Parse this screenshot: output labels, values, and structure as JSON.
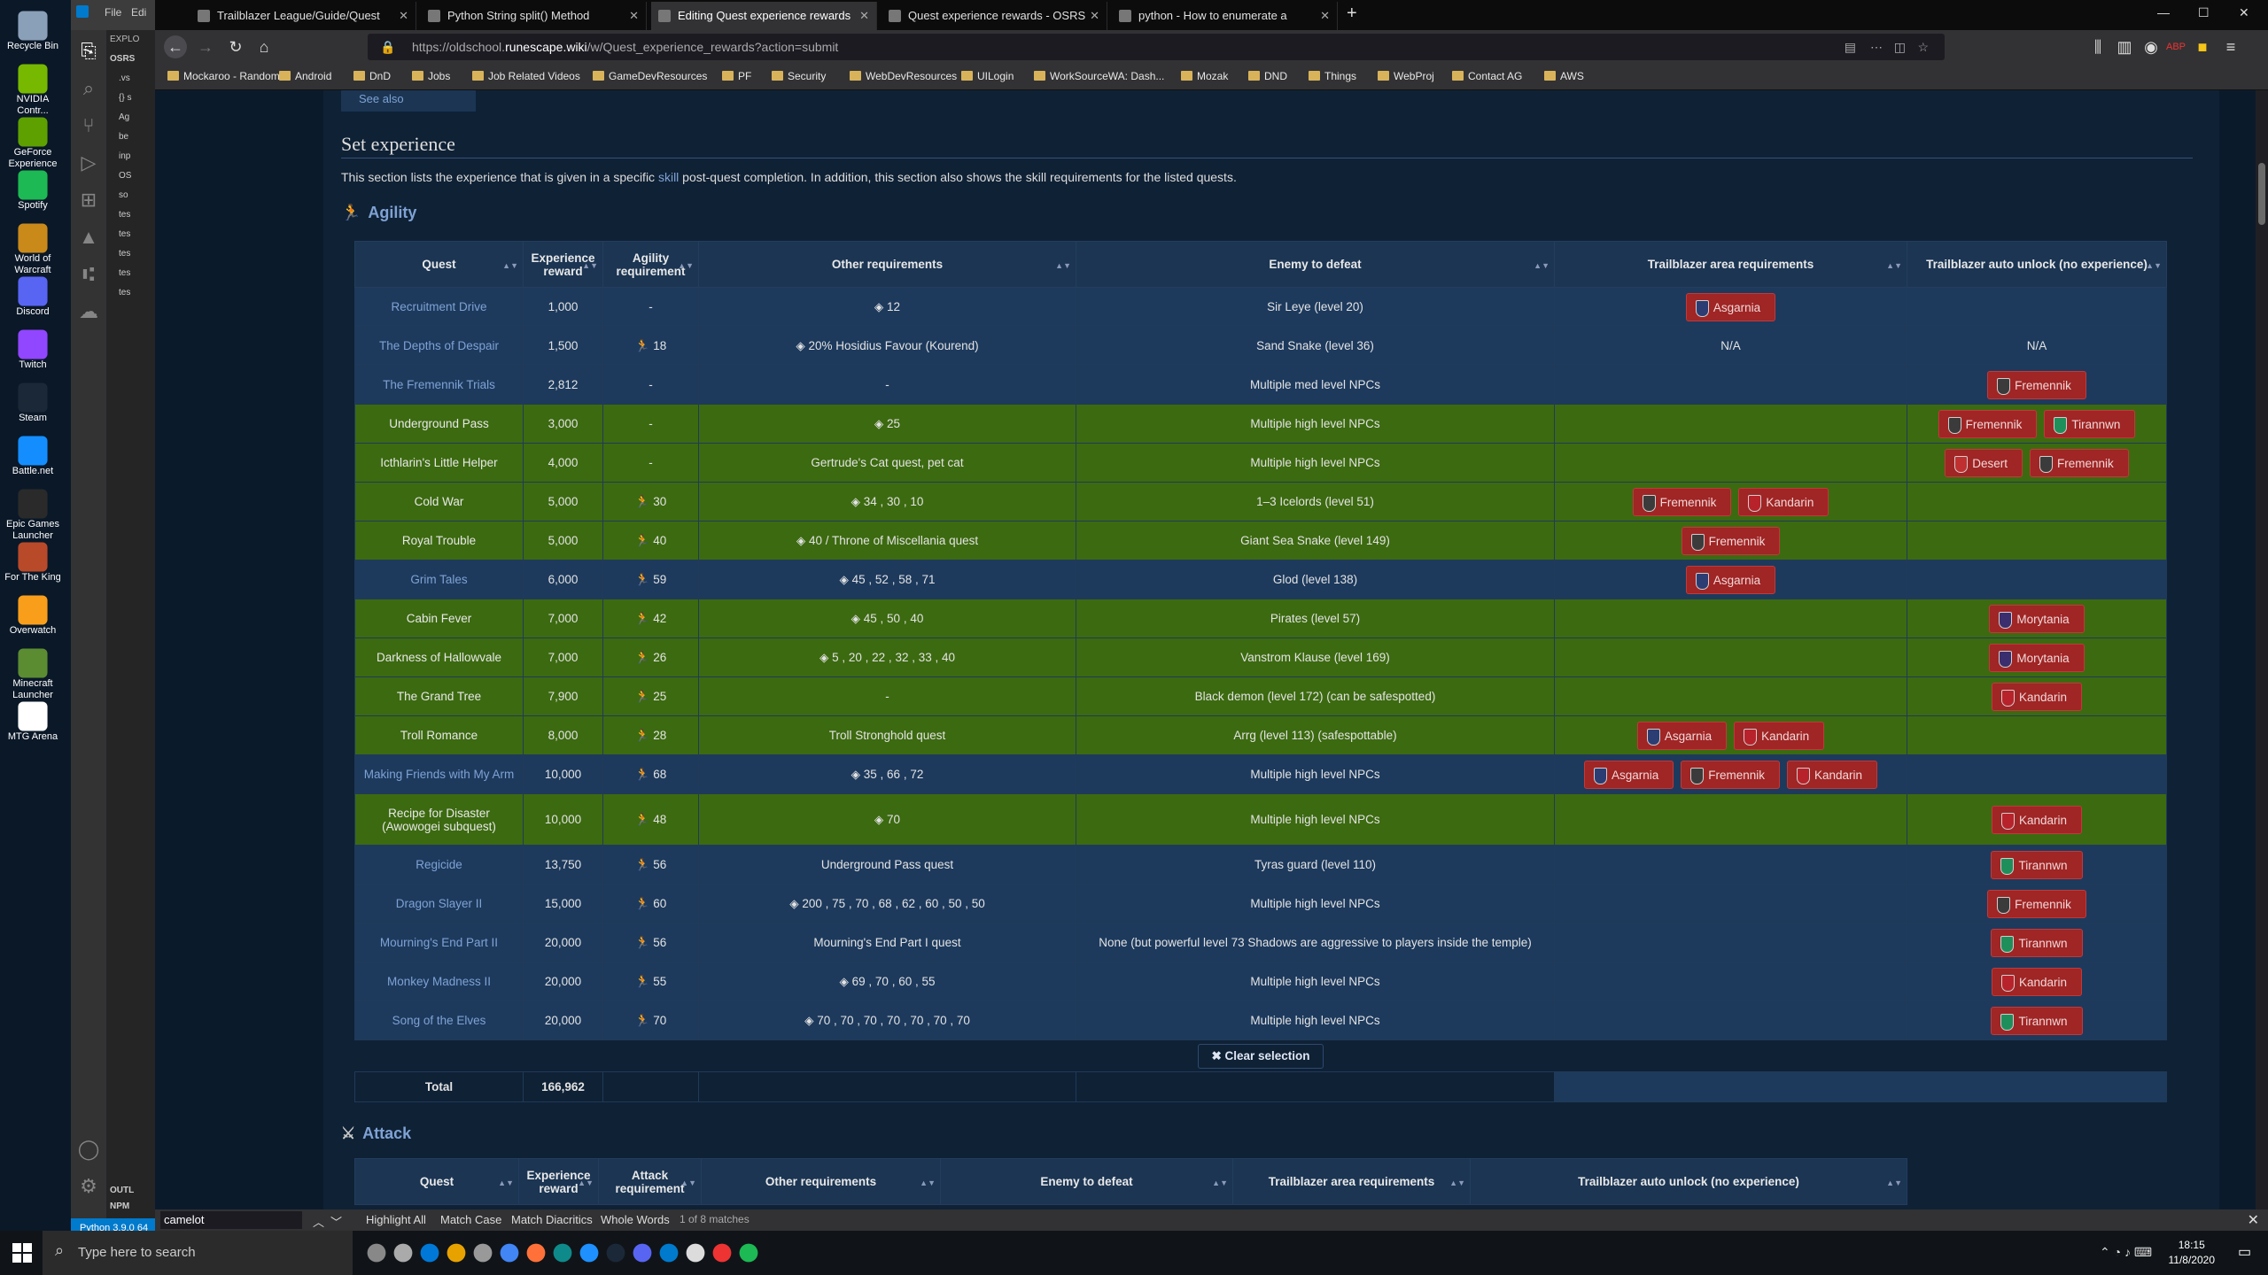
{
  "desktop": {
    "icons": [
      {
        "label": "Recycle Bin",
        "color": "#8aa0b8"
      },
      {
        "label": "NVIDIA Contr...",
        "color": "#76b900"
      },
      {
        "label": "GeForce Experience",
        "color": "#5ea000"
      },
      {
        "label": "Spotify",
        "color": "#1db954"
      },
      {
        "label": "World of Warcraft",
        "color": "#c98a1a"
      },
      {
        "label": "Discord",
        "color": "#5865f2"
      },
      {
        "label": "Twitch",
        "color": "#9146ff"
      },
      {
        "label": "Steam",
        "color": "#1b2838"
      },
      {
        "label": "Battle.net",
        "color": "#148eff"
      },
      {
        "label": "Epic Games Launcher",
        "color": "#2a2a2a"
      },
      {
        "label": "For The King",
        "color": "#b84a2a"
      },
      {
        "label": "Overwatch",
        "color": "#f99e1a"
      },
      {
        "label": "Minecraft Launcher",
        "color": "#5b8c32"
      },
      {
        "label": "MTG Arena",
        "color": "#ffffff"
      }
    ]
  },
  "vscode": {
    "menu": [
      "File",
      "Edi"
    ],
    "explorer_title": "EXPLO",
    "tree": [
      ".vs",
      "{} s",
      "Ag",
      "be",
      "inp",
      "OS",
      "so",
      "tes",
      "tes",
      "tes",
      "tes",
      "tes"
    ],
    "root": "OSRS",
    "outline": "OUTL",
    "npm": "NPM",
    "status": "Python 3.9.0 64"
  },
  "browser": {
    "tabs": [
      {
        "title": "Trailblazer League/Guide/Quest",
        "active": false
      },
      {
        "title": "Python String split() Method",
        "active": false
      },
      {
        "title": "Editing Quest experience rewards",
        "active": true
      },
      {
        "title": "Quest experience rewards - OSRS",
        "active": false
      },
      {
        "title": "python - How to enumerate a",
        "active": false
      }
    ],
    "url_prefix": "https://oldschool.",
    "url_domain": "runescape.wiki",
    "url_suffix": "/w/Quest_experience_rewards?action=submit",
    "bookmarks": [
      "Mockaroo - Random ...",
      "Android",
      "DnD",
      "Jobs",
      "Job Related Videos",
      "GameDevResources",
      "PF",
      "Security",
      "WebDevResources",
      "UILogin",
      "WorkSourceWA: Dash...",
      "Mozak",
      "DND",
      "Things",
      "WebProj",
      "Contact AG",
      "AWS"
    ]
  },
  "page": {
    "see_also": "See also",
    "section_title": "Set experience",
    "intro_before": "This section lists the experience that is given in a specific ",
    "intro_link": "skill",
    "intro_after": " post-quest completion. In addition, this section also shows the skill requirements for the listed quests.",
    "agility": {
      "heading": "Agility",
      "columns": [
        "Quest",
        "Experience reward",
        "Agility requirement",
        "Other requirements",
        "Enemy to defeat",
        "Trailblazer area requirements",
        "Trailblazer auto unlock (no experience)"
      ],
      "rows": [
        {
          "quest": "Recruitment Drive",
          "xp": "1,000",
          "req": "-",
          "other": "12",
          "enemy": "Sir Leye (level 20)",
          "areas": [
            "Asgarnia"
          ],
          "auto": [],
          "style": "blue"
        },
        {
          "quest": "The Depths of Despair",
          "xp": "1,500",
          "req": "18",
          "other": "20% Hosidius Favour (Kourend)",
          "enemy": "Sand Snake (level 36)",
          "areas_text": "N/A",
          "auto_text": "N/A",
          "areas": [],
          "auto": [],
          "style": "blue"
        },
        {
          "quest": "The Fremennik Trials",
          "xp": "2,812",
          "req": "-",
          "other": "-",
          "enemy": "Multiple med level NPCs",
          "areas": [],
          "auto": [
            "Fremennik"
          ],
          "style": "blue"
        },
        {
          "quest": "Underground Pass",
          "xp": "3,000",
          "req": "-",
          "other": "25",
          "enemy": "Multiple high level NPCs",
          "areas": [],
          "auto": [
            "Fremennik",
            "Tirannwn"
          ],
          "style": "green"
        },
        {
          "quest": "Icthlarin's Little Helper",
          "xp": "4,000",
          "req": "-",
          "other": "Gertrude's Cat quest, pet cat",
          "enemy": "Multiple high level NPCs",
          "areas": [],
          "auto": [
            "Desert",
            "Fremennik"
          ],
          "style": "green"
        },
        {
          "quest": "Cold War",
          "xp": "5,000",
          "req": "30",
          "other": "34 , 30 , 10",
          "enemy": "1–3 Icelords (level 51)",
          "areas": [
            "Fremennik",
            "Kandarin"
          ],
          "auto": [],
          "style": "green"
        },
        {
          "quest": "Royal Trouble",
          "xp": "5,000",
          "req": "40",
          "other": "40 / Throne of Miscellania quest",
          "enemy": "Giant Sea Snake (level 149)",
          "areas": [
            "Fremennik"
          ],
          "auto": [],
          "style": "green"
        },
        {
          "quest": "Grim Tales",
          "xp": "6,000",
          "req": "59",
          "other": "45 , 52 , 58 , 71",
          "enemy": "Glod (level 138)",
          "areas": [
            "Asgarnia"
          ],
          "auto": [],
          "style": "blue"
        },
        {
          "quest": "Cabin Fever",
          "xp": "7,000",
          "req": "42",
          "other": "45 , 50 , 40",
          "enemy": "Pirates (level 57)",
          "areas": [],
          "auto": [
            "Morytania"
          ],
          "style": "green"
        },
        {
          "quest": "Darkness of Hallowvale",
          "xp": "7,000",
          "req": "26",
          "other": "5 , 20 , 22 , 32 , 33 , 40",
          "enemy": "Vanstrom Klause (level 169)",
          "areas": [],
          "auto": [
            "Morytania"
          ],
          "style": "green"
        },
        {
          "quest": "The Grand Tree",
          "xp": "7,900",
          "req": "25",
          "other": "-",
          "enemy": "Black demon (level 172) (can be safespotted)",
          "areas": [],
          "auto": [
            "Kandarin"
          ],
          "style": "green"
        },
        {
          "quest": "Troll Romance",
          "xp": "8,000",
          "req": "28",
          "other": "Troll Stronghold quest",
          "enemy": "Arrg (level 113) (safespottable)",
          "areas": [
            "Asgarnia",
            "Kandarin"
          ],
          "auto": [],
          "style": "green"
        },
        {
          "quest": "Making Friends with My Arm",
          "xp": "10,000",
          "req": "68",
          "other": "35 , 66 , 72",
          "enemy": "Multiple high level NPCs",
          "areas": [
            "Asgarnia",
            "Fremennik",
            "Kandarin"
          ],
          "auto": [],
          "style": "blue"
        },
        {
          "quest": "Recipe for Disaster (Awowogei subquest)",
          "xp": "10,000",
          "req": "48",
          "other": "70",
          "enemy": "Multiple high level NPCs",
          "areas": [],
          "auto": [
            "Kandarin"
          ],
          "style": "green"
        },
        {
          "quest": "Regicide",
          "xp": "13,750",
          "req": "56",
          "other": "Underground Pass quest",
          "enemy": "Tyras guard (level 110)",
          "areas": [],
          "auto": [
            "Tirannwn"
          ],
          "style": "blue"
        },
        {
          "quest": "Dragon Slayer II",
          "xp": "15,000",
          "req": "60",
          "other": "200 , 75 , 70 , 68 , 62 , 60 , 50 , 50",
          "enemy": "Multiple high level NPCs",
          "areas": [],
          "auto": [
            "Fremennik"
          ],
          "style": "blue"
        },
        {
          "quest": "Mourning's End Part II",
          "xp": "20,000",
          "req": "56",
          "other": "Mourning's End Part I quest",
          "enemy": "None (but powerful level 73 Shadows are aggressive to players inside the temple)",
          "areas": [],
          "auto": [
            "Tirannwn"
          ],
          "style": "blue"
        },
        {
          "quest": "Monkey Madness II",
          "xp": "20,000",
          "req": "55",
          "other": "69 , 70 , 60 , 55",
          "enemy": "Multiple high level NPCs",
          "areas": [],
          "auto": [
            "Kandarin"
          ],
          "style": "blue"
        },
        {
          "quest": "Song of the Elves",
          "xp": "20,000",
          "req": "70",
          "other": "70 , 70 , 70 , 70 , 70 , 70 , 70",
          "enemy": "Multiple high level NPCs",
          "areas": [],
          "auto": [
            "Tirannwn"
          ],
          "style": "blue"
        }
      ],
      "clear_selection": "Clear selection",
      "total_label": "Total",
      "total_value": "166,962"
    },
    "attack": {
      "heading": "Attack",
      "columns": [
        "Quest",
        "Experience reward",
        "Attack requirement",
        "Other requirements",
        "Enemy to defeat",
        "Trailblazer area requirements",
        "Trailblazer auto unlock (no experience)"
      ]
    }
  },
  "findbar": {
    "query": "camelot",
    "options": [
      "Highlight All",
      "Match Case",
      "Match Diacritics",
      "Whole Words"
    ],
    "status": "1 of 8 matches"
  },
  "taskbar": {
    "search_placeholder": "Type here to search",
    "time": "18:15",
    "date": "11/8/2020"
  }
}
